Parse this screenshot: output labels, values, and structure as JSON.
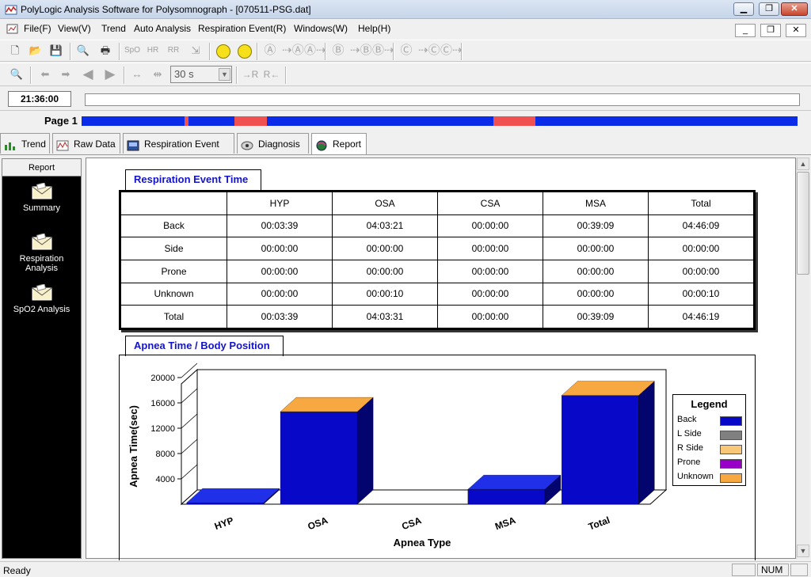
{
  "window": {
    "title": "PolyLogic Analysis Software for Polysomnograph - [070511-PSG.dat]"
  },
  "menu": [
    "File(F)",
    "View(V)",
    "Trend",
    "Auto Analysis",
    "Respiration Event(R)",
    "Windows(W)",
    "Help(H)"
  ],
  "toolbar": {
    "zoom_options": [
      "30 s"
    ],
    "zoom_value": "30 s",
    "buttons_row1": [
      "new-doc-icon",
      "open-folder-icon",
      "save-icon",
      "print-preview-icon",
      "print-icon",
      "spo2-icon",
      "hr-icon",
      "rr-icon",
      "export-icon",
      "smiley-icon",
      "smiley-b-icon",
      "circle-a-icon",
      "circle-a-left-icon",
      "circle-a-right-icon",
      "circle-b-icon",
      "circle-b-left-icon",
      "circle-b-right-icon",
      "circle-c-icon",
      "circle-c-left-icon",
      "circle-c-right-icon"
    ],
    "r_label": "R",
    "r_left_label": "→R",
    "r_right_label": "R←"
  },
  "time": {
    "current": "21:36:00"
  },
  "page": {
    "label": "Page 1",
    "segments": [
      {
        "start": 0.144,
        "end": 0.15,
        "color": "#f05050"
      },
      {
        "start": 0.214,
        "end": 0.259,
        "color": "#f05050"
      },
      {
        "start": 0.575,
        "end": 0.634,
        "color": "#f05050"
      }
    ]
  },
  "tabs": [
    {
      "label": "Trend",
      "icon": "trend-chart-icon",
      "active": false
    },
    {
      "label": "Raw Data",
      "icon": "raw-data-icon",
      "active": false
    },
    {
      "label": "Respiration Event",
      "icon": "respiration-event-icon",
      "active": false
    },
    {
      "label": "Diagnosis",
      "icon": "diagnosis-icon",
      "active": false
    },
    {
      "label": "Report",
      "icon": "report-globe-icon",
      "active": true
    }
  ],
  "report_panel": {
    "header": "Report",
    "items": [
      "Summary",
      "Respiration Analysis",
      "SpO2 Analysis"
    ]
  },
  "respiration_table": {
    "title": "Respiration Event Time",
    "columns": [
      "",
      "HYP",
      "OSA",
      "CSA",
      "MSA",
      "Total"
    ],
    "rows": [
      [
        "Back",
        "00:03:39",
        "04:03:21",
        "00:00:00",
        "00:39:09",
        "04:46:09"
      ],
      [
        "Side",
        "00:00:00",
        "00:00:00",
        "00:00:00",
        "00:00:00",
        "00:00:00"
      ],
      [
        "Prone",
        "00:00:00",
        "00:00:00",
        "00:00:00",
        "00:00:00",
        "00:00:00"
      ],
      [
        "Unknown",
        "00:00:00",
        "00:00:10",
        "00:00:00",
        "00:00:00",
        "00:00:10"
      ],
      [
        "Total",
        "00:03:39",
        "04:03:31",
        "00:00:00",
        "00:39:09",
        "04:46:19"
      ]
    ]
  },
  "chart_title": "Apnea Time / Body Position",
  "chart_data": {
    "type": "bar",
    "title": "",
    "xlabel": "Apnea Type",
    "ylabel": "Apnea Time(sec)",
    "categories": [
      "HYP",
      "OSA",
      "CSA",
      "MSA",
      "Total"
    ],
    "yticks": [
      "4000",
      "8000",
      "12000",
      "16000",
      "20000"
    ],
    "ylim": [
      0,
      20000
    ],
    "stacked": true,
    "series": [
      {
        "name": "Back",
        "color": "#0808c8",
        "values": [
          219,
          14601,
          0,
          2349,
          17169
        ]
      },
      {
        "name": "L Side",
        "color": "#808080",
        "values": [
          0,
          0,
          0,
          0,
          0
        ]
      },
      {
        "name": "R Side",
        "color": "#f8c878",
        "values": [
          0,
          0,
          0,
          0,
          0
        ]
      },
      {
        "name": "Prone",
        "color": "#9800c8",
        "values": [
          0,
          0,
          0,
          0,
          0
        ]
      },
      {
        "name": "Unknown",
        "color": "#f8a840",
        "values": [
          0,
          10,
          0,
          0,
          10
        ]
      }
    ],
    "legend_title": "Legend",
    "legend_position": "right"
  },
  "status": {
    "text": "Ready",
    "num": "NUM"
  }
}
